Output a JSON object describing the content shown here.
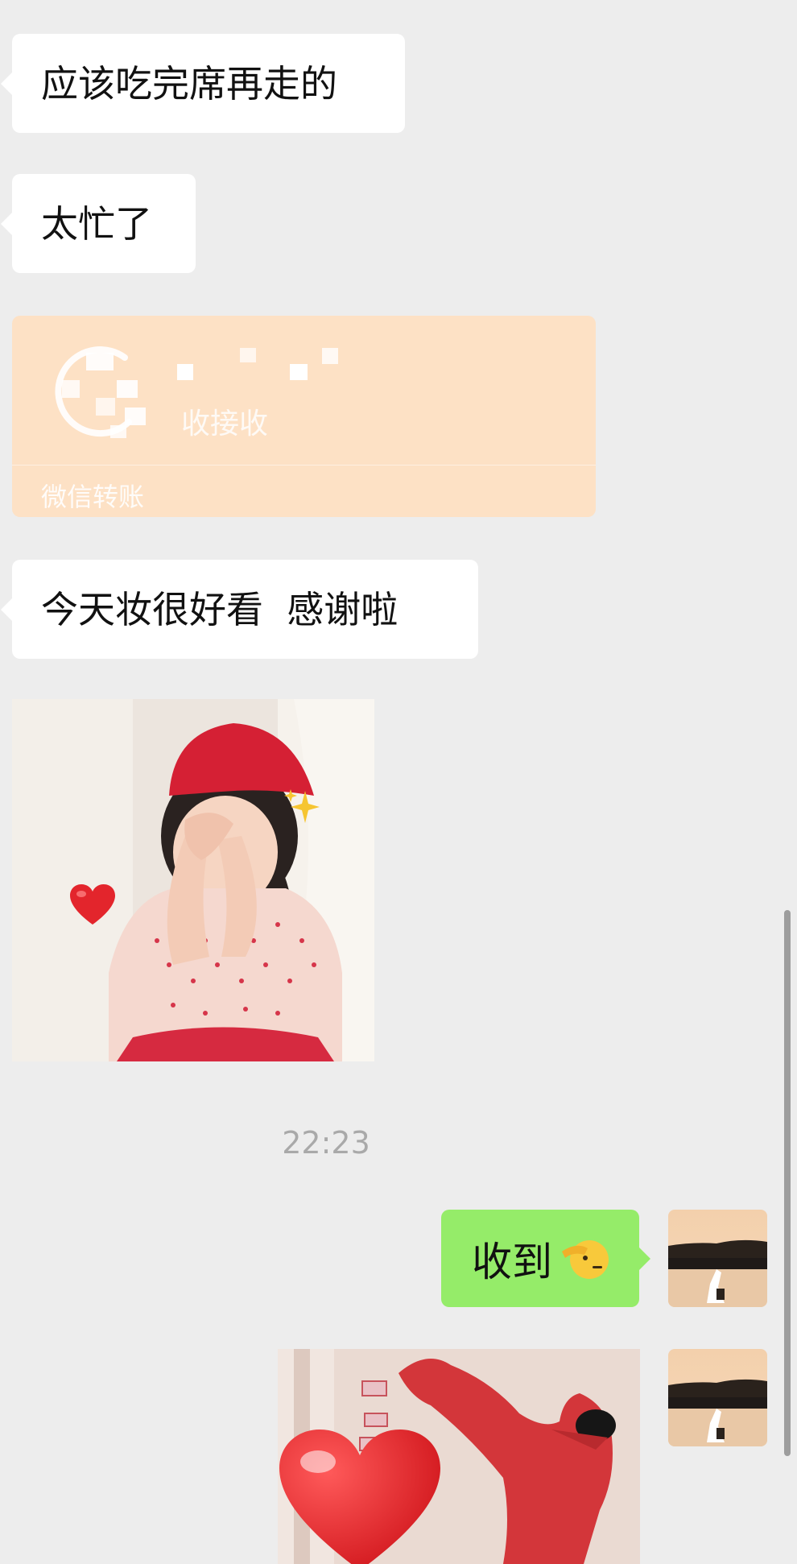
{
  "messages": {
    "msg1": "应该吃完席再走的",
    "msg2": "太忙了",
    "msg4": "今天妆很好看  感谢啦",
    "msg5": "收到"
  },
  "transfer": {
    "status_partial": "收接收",
    "footer": "微信转账"
  },
  "timestamp": "22:23",
  "colors": {
    "background": "#ededed",
    "bubble_in": "#ffffff",
    "bubble_out": "#95ec69",
    "transfer": "#fde1c5"
  },
  "icons": {
    "salute_emoji": "saluting-face-icon",
    "heart": "red-heart-icon",
    "sparkles": "sparkles-icon"
  }
}
